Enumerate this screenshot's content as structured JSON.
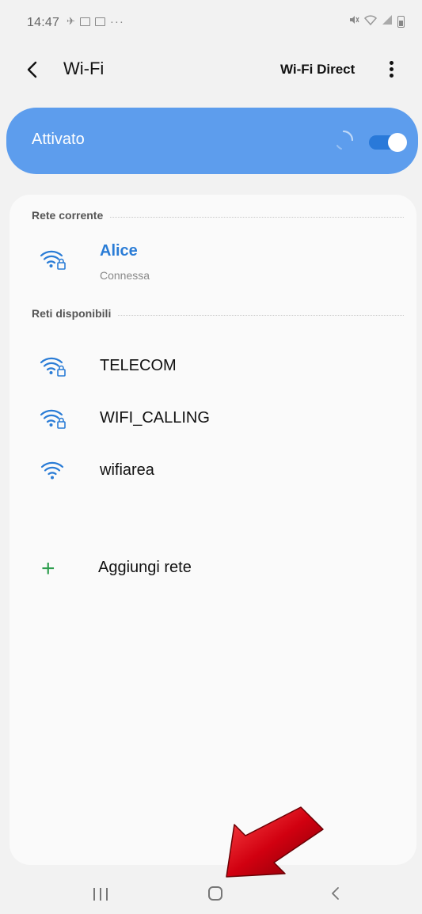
{
  "status_bar": {
    "time": "14:47",
    "overflow": "···"
  },
  "header": {
    "title": "Wi-Fi",
    "wifi_direct": "Wi-Fi Direct"
  },
  "toggle": {
    "label": "Attivato",
    "state": "on"
  },
  "current_network": {
    "section_title": "Rete corrente",
    "name": "Alice",
    "status": "Connessa",
    "icon": "wifi-locked-icon"
  },
  "available_networks": {
    "section_title": "Reti disponibili",
    "items": [
      {
        "name": "TELECOM",
        "icon": "wifi-locked-icon"
      },
      {
        "name": "WIFI_CALLING",
        "icon": "wifi-locked-icon"
      },
      {
        "name": "wifiarea",
        "icon": "wifi-icon"
      }
    ]
  },
  "add_network": {
    "label": "Aggiungi rete",
    "icon": "plus-icon"
  },
  "colors": {
    "accent": "#5d9ded",
    "switch_on": "#2979d9",
    "link": "#2a7cd6",
    "add_green": "#2e9e4e",
    "annotation_red": "#c4000a"
  }
}
